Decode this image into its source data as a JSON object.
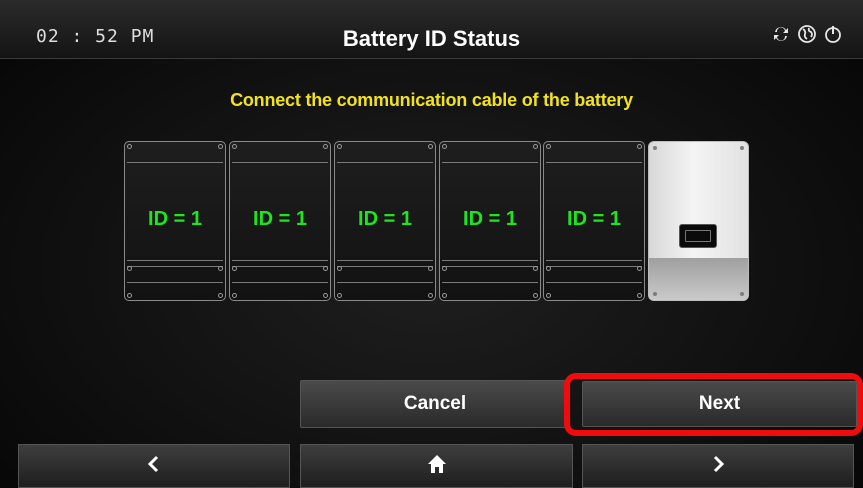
{
  "header": {
    "time": "02 : 52 PM",
    "title": "Battery ID Status",
    "icons": [
      "sync-icon",
      "globe-icon",
      "power-icon"
    ]
  },
  "instruction": "Connect the communication cable of the battery",
  "batteries": [
    {
      "label": "ID = 1"
    },
    {
      "label": "ID = 1"
    },
    {
      "label": "ID = 1"
    },
    {
      "label": "ID = 1"
    },
    {
      "label": "ID = 1"
    }
  ],
  "buttons": {
    "cancel": "Cancel",
    "next": "Next"
  },
  "nav": {
    "back": "chevron-left-icon",
    "home": "home-icon",
    "forward": "chevron-right-icon"
  },
  "colors": {
    "instruction": "#f2e21a",
    "id_label": "#1ee61e",
    "highlight": "#f00c0c"
  }
}
